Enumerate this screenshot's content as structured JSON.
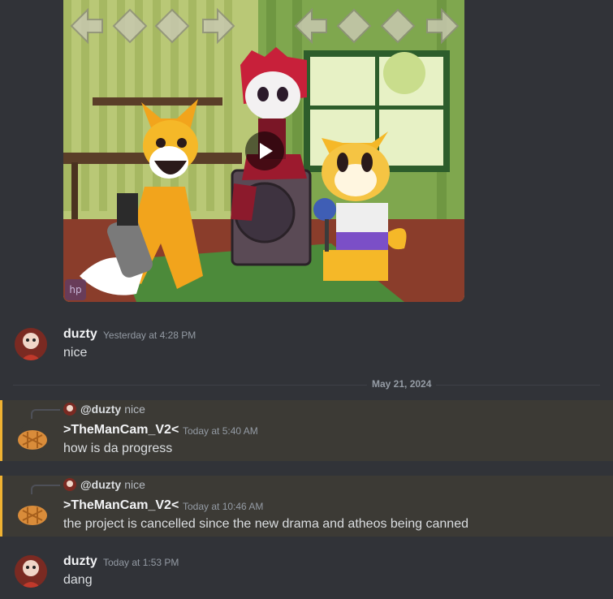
{
  "video": {
    "watermark": "hp",
    "play_icon": "play-icon"
  },
  "messages": [
    {
      "author": "duzty",
      "timestamp": "Yesterday at 4:28 PM",
      "text": "nice"
    },
    {
      "reply_to_author": "@duzty",
      "reply_to_text": "nice",
      "author": ">TheManCam_V2<",
      "timestamp": "Today at 5:40 AM",
      "text": "how is da progress"
    },
    {
      "reply_to_author": "@duzty",
      "reply_to_text": "nice",
      "author": ">TheManCam_V2<",
      "timestamp": "Today at 10:46 AM",
      "text": "the project is cancelled since the new drama and atheos being canned"
    },
    {
      "author": "duzty",
      "timestamp": "Today at 1:53 PM",
      "text": "dang"
    }
  ],
  "date_divider": "May 21, 2024",
  "colors": {
    "background": "#313338",
    "highlight": "#3c3a35",
    "mention_bar": "#f0b232"
  }
}
